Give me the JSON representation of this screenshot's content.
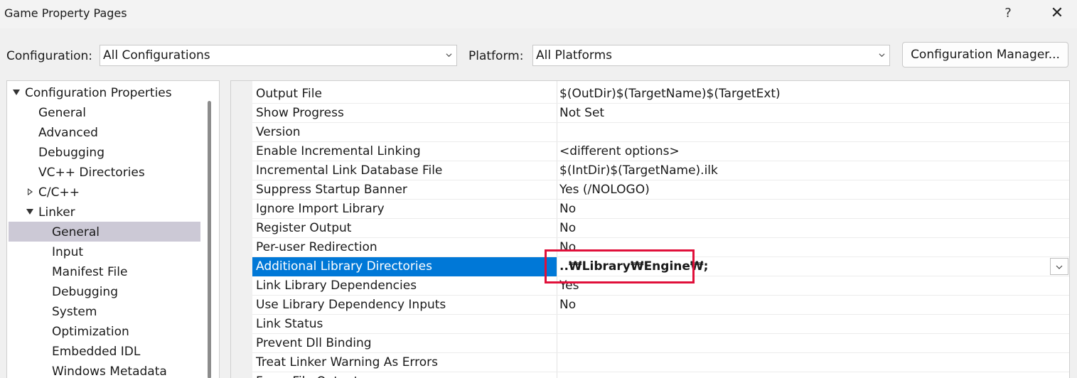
{
  "window": {
    "title": "Game Property Pages",
    "help_label": "?",
    "close_label": "✕"
  },
  "toolbar": {
    "configuration_label": "Configuration:",
    "configuration_value": "All Configurations",
    "platform_label": "Platform:",
    "platform_value": "All Platforms",
    "config_manager_label": "Configuration Manager..."
  },
  "tree": {
    "items": [
      {
        "label": "Configuration Properties"
      },
      {
        "label": "General"
      },
      {
        "label": "Advanced"
      },
      {
        "label": "Debugging"
      },
      {
        "label": "VC++ Directories"
      },
      {
        "label": "C/C++"
      },
      {
        "label": "Linker"
      },
      {
        "label": "General",
        "selected": true
      },
      {
        "label": "Input"
      },
      {
        "label": "Manifest File"
      },
      {
        "label": "Debugging"
      },
      {
        "label": "System"
      },
      {
        "label": "Optimization"
      },
      {
        "label": "Embedded IDL"
      },
      {
        "label": "Windows Metadata"
      }
    ]
  },
  "grid": {
    "rows": [
      {
        "name": "Output File",
        "value": "$(OutDir)$(TargetName)$(TargetExt)"
      },
      {
        "name": "Show Progress",
        "value": "Not Set"
      },
      {
        "name": "Version",
        "value": ""
      },
      {
        "name": "Enable Incremental Linking",
        "value": "<different options>"
      },
      {
        "name": "Incremental Link Database File",
        "value": "$(IntDir)$(TargetName).ilk"
      },
      {
        "name": "Suppress Startup Banner",
        "value": "Yes (/NOLOGO)"
      },
      {
        "name": "Ignore Import Library",
        "value": "No"
      },
      {
        "name": "Register Output",
        "value": "No"
      },
      {
        "name": "Per-user Redirection",
        "value": "No"
      },
      {
        "name": "Additional Library Directories",
        "value": "..₩Library₩Engine₩;",
        "selected": true
      },
      {
        "name": "Link Library Dependencies",
        "value": "Yes"
      },
      {
        "name": "Use Library Dependency Inputs",
        "value": "No"
      },
      {
        "name": "Link Status",
        "value": ""
      },
      {
        "name": "Prevent Dll Binding",
        "value": ""
      },
      {
        "name": "Treat Linker Warning As Errors",
        "value": ""
      },
      {
        "name": "Force File Output",
        "value": ""
      }
    ]
  },
  "colors": {
    "selection": "#0078d7",
    "tree_selection": "#ccc9d6",
    "highlight_border": "#e0103a"
  }
}
